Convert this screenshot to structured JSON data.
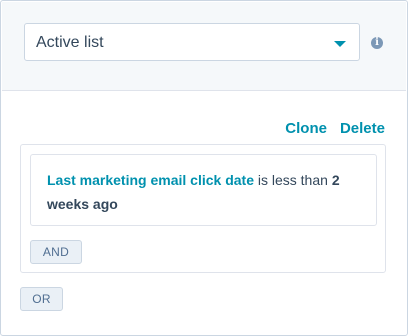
{
  "list_type": {
    "selected": "Active list"
  },
  "actions": {
    "clone_label": "Clone",
    "delete_label": "Delete"
  },
  "filter": {
    "property": "Last marketing email click date",
    "operator": " is less than ",
    "value_part1": "2",
    "value_part2": "weeks ago"
  },
  "buttons": {
    "and_label": "AND",
    "or_label": "OR"
  },
  "colors": {
    "accent": "#0091ae",
    "text": "#33475b",
    "header_bg": "#f5f8fa",
    "button_bg": "#eaf0f6"
  }
}
